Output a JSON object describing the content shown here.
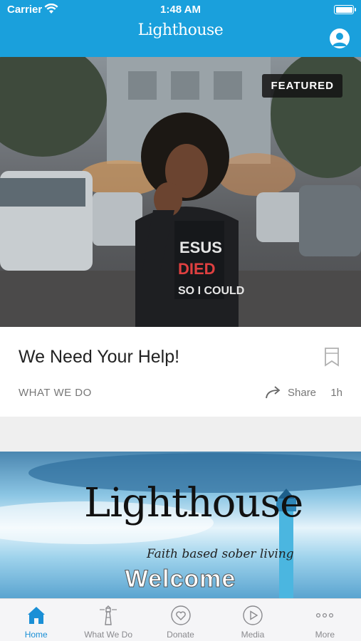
{
  "status_bar": {
    "carrier": "Carrier",
    "time": "1:48 AM"
  },
  "header": {
    "logo_text": "Lighthouse"
  },
  "featured": {
    "badge": "FEATURED",
    "title": "We Need Your Help!",
    "category": "WHAT WE DO",
    "share_label": "Share",
    "age": "1h"
  },
  "welcome_card": {
    "logo_text": "Lighthouse",
    "tagline": "Faith based sober living",
    "welcome": "Welcome"
  },
  "tabs": [
    {
      "label": "Home",
      "icon": "home-icon",
      "active": true
    },
    {
      "label": "What We Do",
      "icon": "lighthouse-icon",
      "active": false
    },
    {
      "label": "Donate",
      "icon": "heart-icon",
      "active": false
    },
    {
      "label": "Media",
      "icon": "play-icon",
      "active": false
    },
    {
      "label": "More",
      "icon": "more-icon",
      "active": false
    }
  ],
  "colors": {
    "brand": "#1aa0dc",
    "active_tab": "#1a8fd6"
  }
}
